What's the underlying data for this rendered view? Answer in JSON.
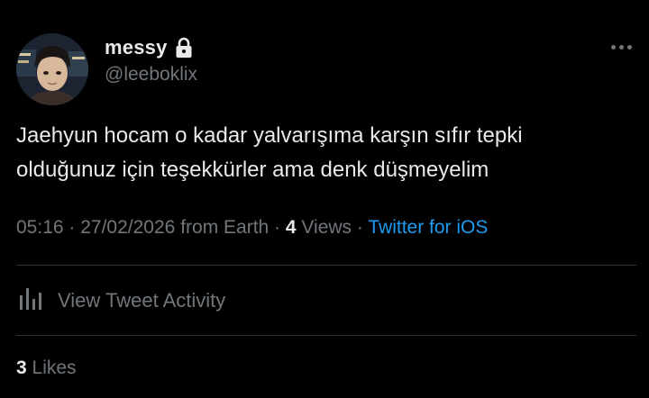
{
  "author": {
    "display_name": "messy",
    "handle": "@leeboklix",
    "avatar_icon": "user-avatar-photo",
    "protected_icon": "lock-icon"
  },
  "tweet": {
    "text_line_1": "Jaehyun hocam o kadar yalvarışıma karşın sıfır tepki",
    "text_line_2": "olduğunuz için teşekkürler ama denk düşmeyelim"
  },
  "meta": {
    "time": "05:16",
    "separator": " · ",
    "date": "27/02/2026",
    "location": "from Earth",
    "views_count": "4",
    "views_label": "Views",
    "source": "Twitter for iOS"
  },
  "activity": {
    "label": "View Tweet Activity",
    "icon": "analytics-bars-icon"
  },
  "likes": {
    "count": "3",
    "label": "Likes"
  },
  "menu": {
    "icon": "more-options-icon"
  },
  "colors": {
    "background": "#000000",
    "primary_text": "#e7e9ea",
    "secondary_text": "#71767b",
    "accent": "#1d9bf0",
    "divider": "#2f3336"
  }
}
